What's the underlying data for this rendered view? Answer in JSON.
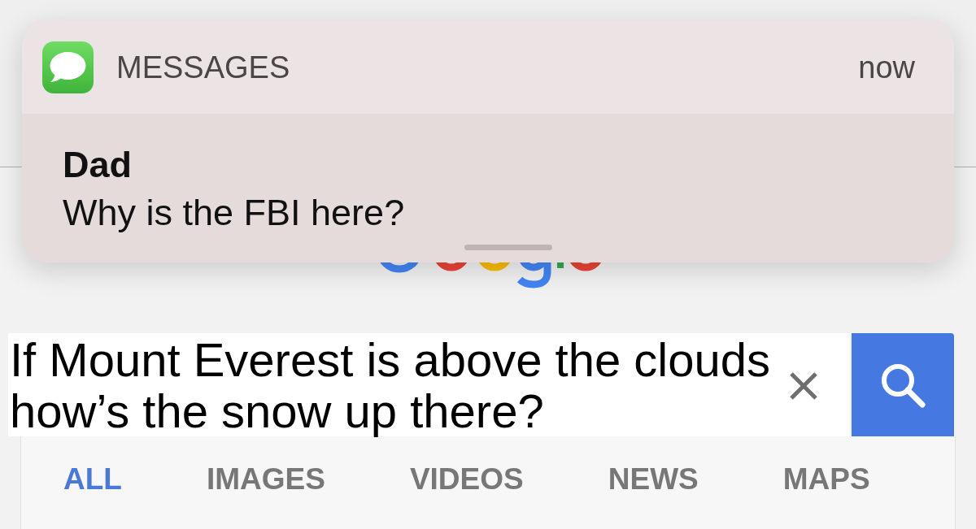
{
  "notification": {
    "app_name": "MESSAGES",
    "time": "now",
    "sender": "Dad",
    "message": "Why is the FBI here?"
  },
  "search": {
    "value": "If Mount Everest is above the clouds how’s the snow up there?"
  },
  "tabs": [
    {
      "label": "ALL",
      "selected": true
    },
    {
      "label": "IMAGES",
      "selected": false
    },
    {
      "label": "VIDEOS",
      "selected": false
    },
    {
      "label": "NEWS",
      "selected": false
    },
    {
      "label": "MAPS",
      "selected": false
    }
  ]
}
